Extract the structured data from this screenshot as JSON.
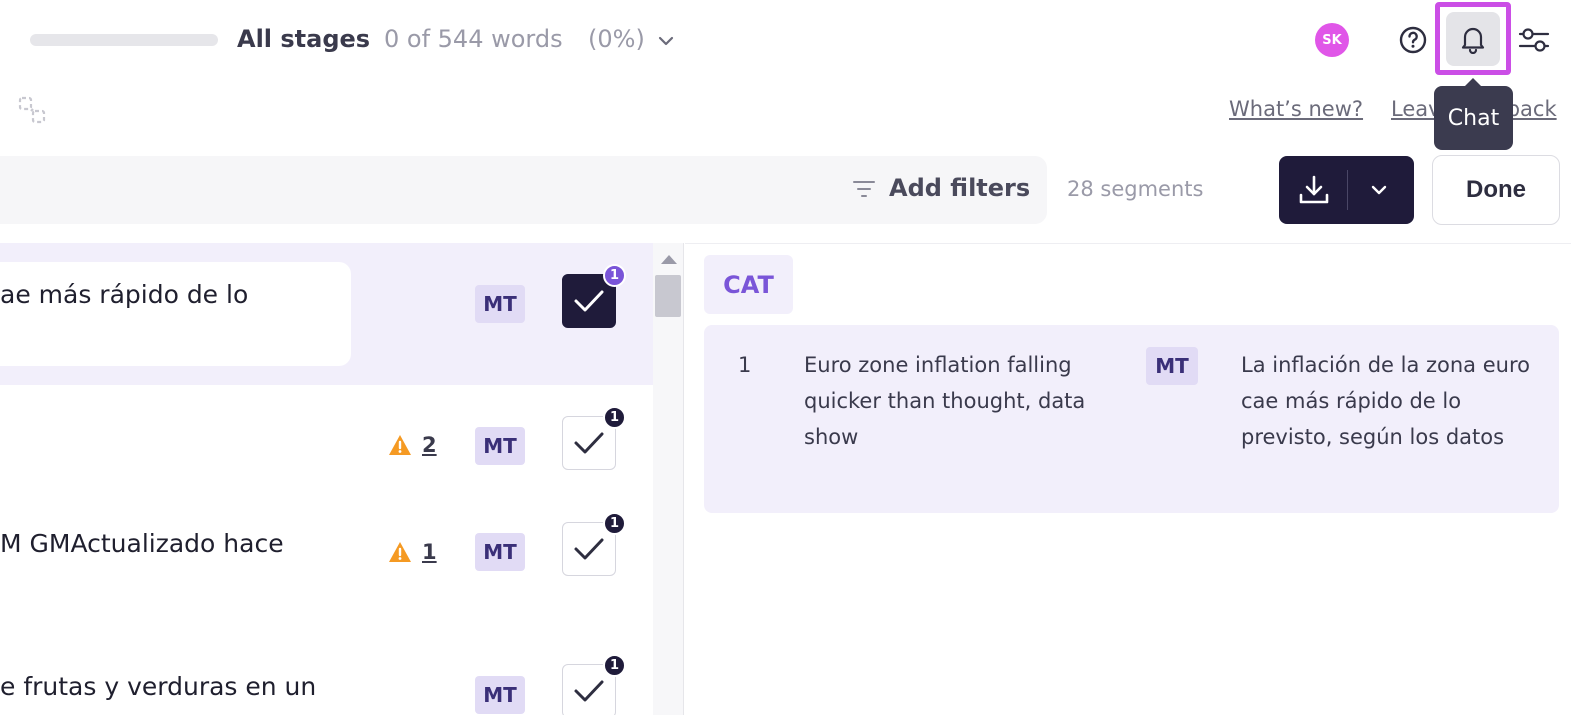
{
  "header": {
    "stage_label": "All stages",
    "word_count": "0 of 544 words",
    "word_percent": "(0%)",
    "avatar_initials": "SK",
    "tooltip": "Chat"
  },
  "links": {
    "whats_new": "What’s new?",
    "leave_feedback": "Leave feedback"
  },
  "filters": {
    "add_filters": "Add filters",
    "segments": "28 segments"
  },
  "actions": {
    "done": "Done"
  },
  "segments": [
    {
      "text": "ae más rápido de lo",
      "badge": "MT",
      "warnings": "",
      "count": "1",
      "confirmed": true
    },
    {
      "text": "",
      "badge": "MT",
      "warnings": "2",
      "count": "1",
      "confirmed": false
    },
    {
      "text": "M GMActualizado hace",
      "badge": "MT",
      "warnings": "1",
      "count": "1",
      "confirmed": false
    },
    {
      "text": "e frutas y verduras en un",
      "badge": "MT",
      "warnings": "",
      "count": "1",
      "confirmed": false
    }
  ],
  "cat": {
    "tab": "CAT",
    "match": {
      "number": "1",
      "source": "Euro zone inflation falling quicker than thought, data show",
      "badge": "MT",
      "target": "La inflación de la zona euro cae más rápido de lo previsto, según los datos"
    }
  },
  "colors": {
    "accent": "#7a55d8",
    "dark": "#1f1b3a",
    "highlight_border": "#cb4ee6",
    "warning": "#f59a23",
    "avatar": "#e056e8"
  }
}
